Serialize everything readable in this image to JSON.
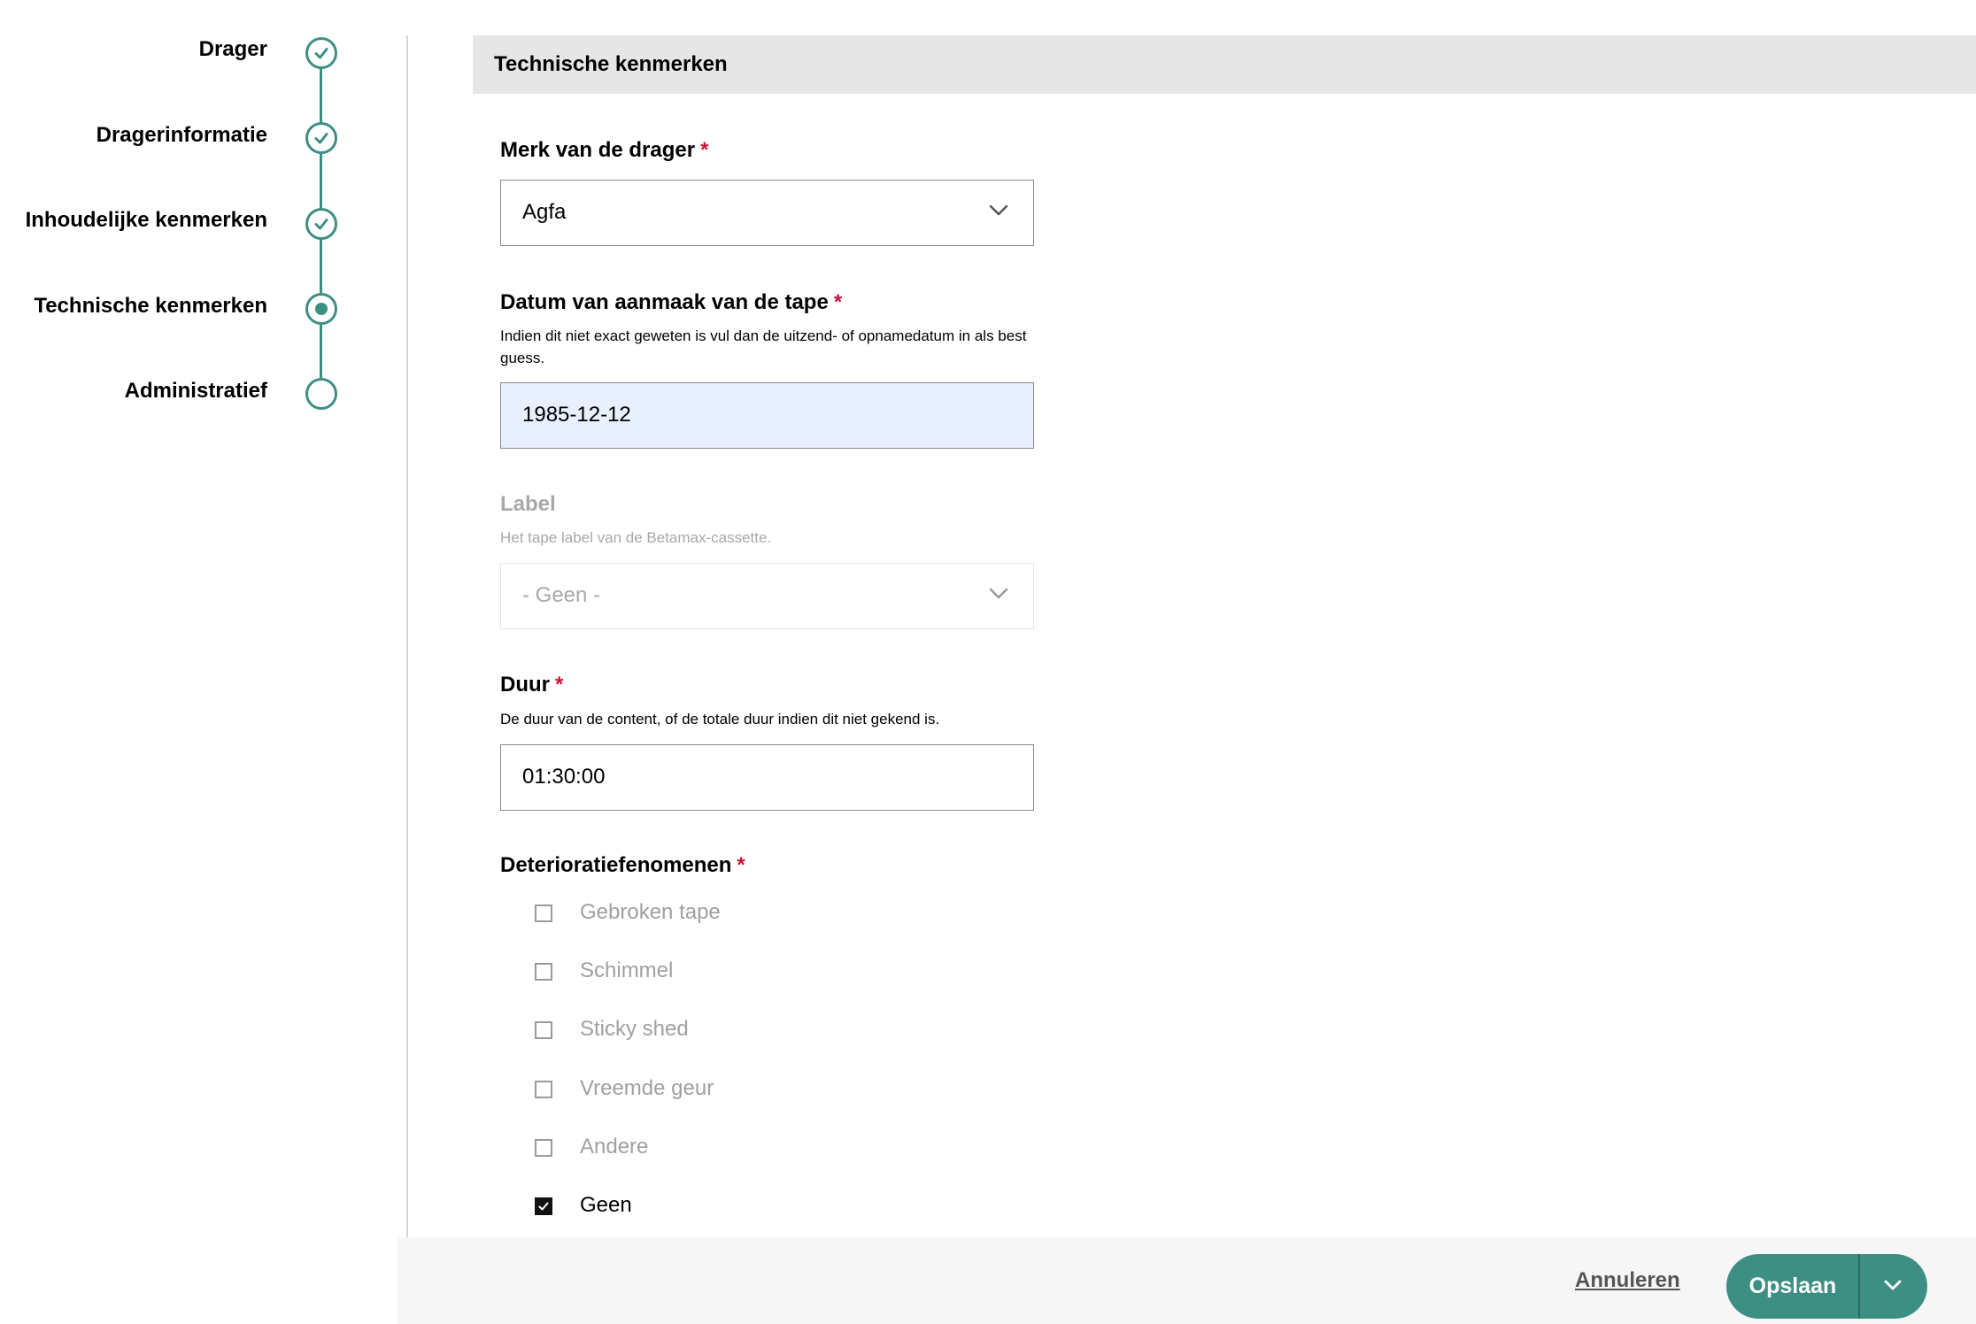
{
  "stepper": {
    "steps": [
      {
        "label": "Drager",
        "state": "done"
      },
      {
        "label": "Dragerinformatie",
        "state": "done"
      },
      {
        "label": "Inhoudelijke kenmerken",
        "state": "done"
      },
      {
        "label": "Technische kenmerken",
        "state": "current"
      },
      {
        "label": "Administratief",
        "state": "todo"
      }
    ]
  },
  "section": {
    "title": "Technische kenmerken"
  },
  "fields": {
    "brand": {
      "label": "Merk van de drager",
      "required": "*",
      "value": "Agfa"
    },
    "date": {
      "label": "Datum van aanmaak van de tape",
      "required": "*",
      "help": "Indien dit niet exact geweten is vul dan de uitzend- of opnamedatum in als best guess.",
      "value": "1985-12-12"
    },
    "tape_label": {
      "label": "Label",
      "help": "Het tape label van de Betamax-cassette.",
      "value": "- Geen -",
      "disabled": true
    },
    "duration": {
      "label": "Duur",
      "required": "*",
      "help": "De duur van de content, of de totale duur indien dit niet gekend is.",
      "value": "01:30:00"
    },
    "deterioration": {
      "label": "Deterioratiefenomenen",
      "required": "*",
      "options": [
        {
          "label": "Gebroken tape",
          "checked": false
        },
        {
          "label": "Schimmel",
          "checked": false
        },
        {
          "label": "Sticky shed",
          "checked": false
        },
        {
          "label": "Vreemde geur",
          "checked": false
        },
        {
          "label": "Andere",
          "checked": false
        },
        {
          "label": "Geen",
          "checked": true
        }
      ]
    }
  },
  "footer": {
    "cancel": "Annuleren",
    "save": "Opslaan"
  },
  "colors": {
    "accent": "#3e8f83",
    "required": "#d0103a",
    "highlight": "#e8efff"
  }
}
